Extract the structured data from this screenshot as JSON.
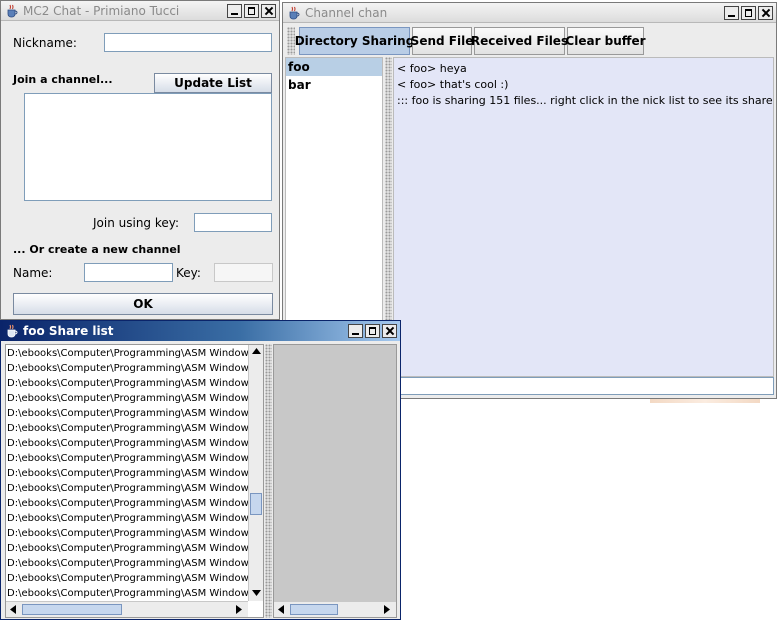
{
  "main_window": {
    "title": "MC2 Chat - Primiano Tucci",
    "nickname_label": "Nickname:",
    "nickname_value": "",
    "join_channel_label": "Join a channel...",
    "update_list_button": "Update List",
    "channel_list": [],
    "join_key_label": "Join using key:",
    "join_key_value": "",
    "create_channel_label": "... Or create a new channel",
    "name_label": "Name:",
    "name_value": "",
    "key_label": "Key:",
    "key_value": "",
    "ok_button": "OK"
  },
  "channel_window": {
    "title": "Channel chan",
    "toolbar": {
      "directory_sharing": "Directory Sharing",
      "send_file": "Send File",
      "received_files": "Received Files",
      "clear_buffer": "Clear buffer"
    },
    "nicks": [
      "foo",
      "bar"
    ],
    "selected_nick": "foo",
    "messages": [
      "< foo> heya",
      "< foo> that's cool :)",
      "::: foo is sharing 151 files... right click in the nick list to see its share"
    ],
    "input_value": ""
  },
  "share_window": {
    "title": "foo Share list",
    "entries": [
      "D:\\ebooks\\Computer\\Programming\\ASM Windows\\",
      "D:\\ebooks\\Computer\\Programming\\ASM Windows\\",
      "D:\\ebooks\\Computer\\Programming\\ASM Windows\\",
      "D:\\ebooks\\Computer\\Programming\\ASM Windows\\",
      "D:\\ebooks\\Computer\\Programming\\ASM Windows\\",
      "D:\\ebooks\\Computer\\Programming\\ASM Windows\\",
      "D:\\ebooks\\Computer\\Programming\\ASM Windows\\",
      "D:\\ebooks\\Computer\\Programming\\ASM Windows\\",
      "D:\\ebooks\\Computer\\Programming\\ASM Windows\\",
      "D:\\ebooks\\Computer\\Programming\\ASM Windows\\",
      "D:\\ebooks\\Computer\\Programming\\ASM Windows\\",
      "D:\\ebooks\\Computer\\Programming\\ASM Windows\\",
      "D:\\ebooks\\Computer\\Programming\\ASM Windows\\",
      "D:\\ebooks\\Computer\\Programming\\ASM Windows\\",
      "D:\\ebooks\\Computer\\Programming\\ASM Windows\\",
      "D:\\ebooks\\Computer\\Programming\\ASM Windows\\",
      "D:\\ebooks\\Computer\\Programming\\ASM Windows\\"
    ]
  },
  "colors": {
    "active_title": "#0a246a",
    "selection": "#b8cfe5",
    "chat_background": "#e3e6f7",
    "pressed_button": "#b9cde6"
  },
  "icons": [
    "java-cup-icon",
    "minimize-icon",
    "maximize-icon",
    "close-icon",
    "scroll-arrow-icon"
  ]
}
